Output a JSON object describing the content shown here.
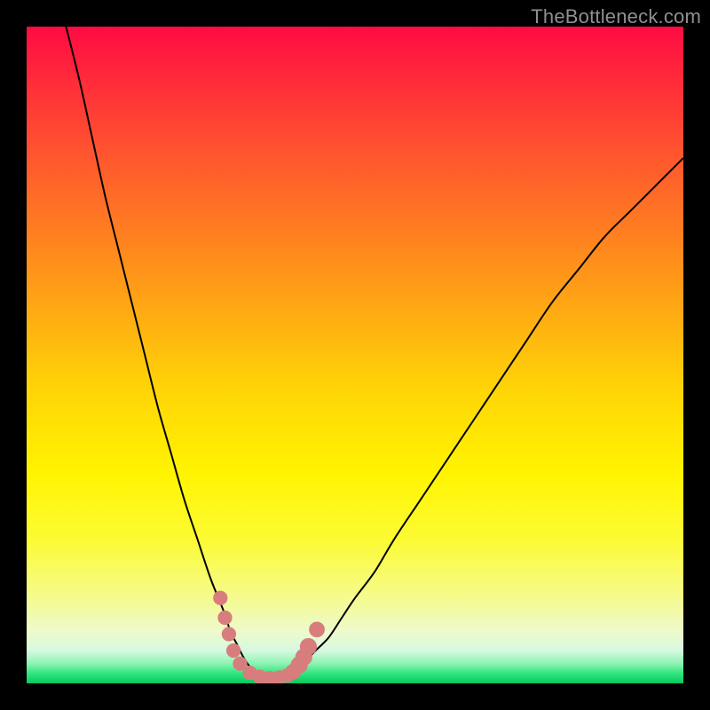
{
  "watermark": "TheBottleneck.com",
  "colors": {
    "frame": "#000000",
    "curve": "#000000",
    "marker": "#d87d7d",
    "marker_stroke": "#d87d7d"
  },
  "chart_data": {
    "type": "line",
    "title": "",
    "xlabel": "",
    "ylabel": "",
    "xlim": [
      0,
      100
    ],
    "ylim": [
      0,
      100
    ],
    "grid": false,
    "legend": false,
    "series": [
      {
        "name": "left-branch",
        "x": [
          6,
          8,
          10,
          12,
          14,
          16,
          18,
          20,
          22,
          24,
          26,
          28,
          30,
          31,
          32,
          33,
          34,
          35
        ],
        "values": [
          100,
          92,
          83,
          74,
          66,
          58,
          50,
          42,
          35,
          28,
          22,
          16,
          11,
          8,
          6,
          4,
          2.5,
          1.5
        ]
      },
      {
        "name": "right-branch",
        "x": [
          40,
          42,
          44,
          46,
          48,
          50,
          53,
          56,
          60,
          64,
          68,
          72,
          76,
          80,
          84,
          88,
          92,
          96,
          100
        ],
        "values": [
          1.5,
          3,
          5,
          7,
          10,
          13,
          17,
          22,
          28,
          34,
          40,
          46,
          52,
          58,
          63,
          68,
          72,
          76,
          80
        ]
      },
      {
        "name": "valley-floor",
        "x": [
          35,
          36,
          37,
          38,
          39,
          40
        ],
        "values": [
          1.5,
          1,
          0.8,
          0.8,
          1,
          1.5
        ]
      }
    ],
    "markers": {
      "name": "dot-series",
      "points": [
        {
          "x": 29.5,
          "y": 13,
          "r": 1.1
        },
        {
          "x": 30.2,
          "y": 10,
          "r": 1.1
        },
        {
          "x": 30.8,
          "y": 7.5,
          "r": 1.1
        },
        {
          "x": 31.5,
          "y": 5.0,
          "r": 1.1
        },
        {
          "x": 32.5,
          "y": 3.0,
          "r": 1.1
        },
        {
          "x": 34.0,
          "y": 1.6,
          "r": 1.1
        },
        {
          "x": 35.5,
          "y": 1.0,
          "r": 1.1
        },
        {
          "x": 37.0,
          "y": 0.8,
          "r": 1.1
        },
        {
          "x": 38.5,
          "y": 0.9,
          "r": 1.1
        },
        {
          "x": 39.7,
          "y": 1.2,
          "r": 1.1
        },
        {
          "x": 40.6,
          "y": 1.8,
          "r": 1.2
        },
        {
          "x": 41.5,
          "y": 2.8,
          "r": 1.3
        },
        {
          "x": 42.2,
          "y": 4.0,
          "r": 1.3
        },
        {
          "x": 42.9,
          "y": 5.6,
          "r": 1.3
        },
        {
          "x": 44.2,
          "y": 8.2,
          "r": 1.2
        }
      ]
    }
  }
}
